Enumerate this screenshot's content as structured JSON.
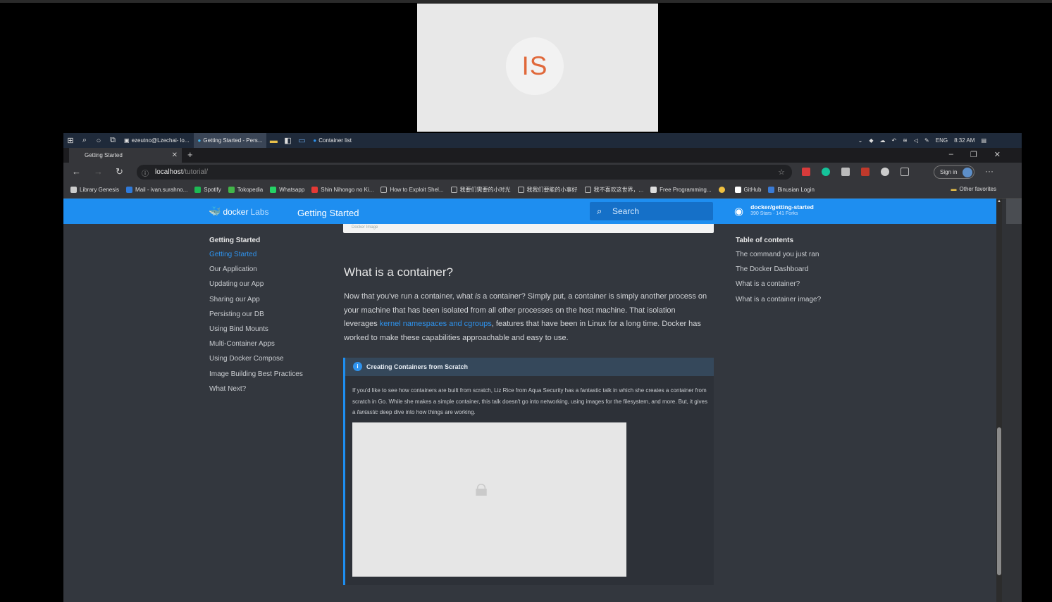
{
  "meeting": {
    "avatar_initials": "IS"
  },
  "taskbar": {
    "apps": [
      {
        "label": "ezeutno@Lzechai- lo..."
      },
      {
        "label": "Getting Started - Pers..."
      },
      {
        "label": "Container list"
      }
    ],
    "lang": "ENG",
    "time": "8:32 AM"
  },
  "browser": {
    "tab_title": "Getting Started",
    "url_host": "localhost",
    "url_path": "/tutorial/",
    "sign_in": "Sign in",
    "bookmarks": [
      {
        "label": "Library Genesis",
        "color": "#cccccc"
      },
      {
        "label": "Mail - ivan.surahno...",
        "color": "#2f7ad9"
      },
      {
        "label": "Spotify",
        "color": "#1db954"
      },
      {
        "label": "Tokopedia",
        "color": "#42b549"
      },
      {
        "label": "Whatsapp",
        "color": "#25d366"
      },
      {
        "label": "Shin Nihongo no Ki...",
        "color": "#e53935"
      },
      {
        "label": "How to Exploit Shel...",
        "color": "#bbbbbb"
      },
      {
        "label": "我要们需要的小时光",
        "color": "#bbbbbb"
      },
      {
        "label": "我我们要能的小事好",
        "color": "#bbbbbb"
      },
      {
        "label": "我不喜欢这世界，...",
        "color": "#bbbbbb"
      },
      {
        "label": "Free Programming...",
        "color": "#dddddd"
      },
      {
        "label": "",
        "color": "#f0c040"
      },
      {
        "label": "GitHub",
        "color": "#ffffff"
      },
      {
        "label": "Binusian Login",
        "color": "#3a7bd5"
      }
    ],
    "other_favorites": "Other favorites"
  },
  "page": {
    "logo_docker": "docker",
    "logo_labs": "Labs",
    "header_title": "Getting Started",
    "search_placeholder": "Search",
    "repo_name": "docker/getting-started",
    "repo_stats": "390 Stars · 141 Forks",
    "image_badge": "Docker Image",
    "nav_section": "Getting Started",
    "nav_items": [
      "Getting Started",
      "Our Application",
      "Updating our App",
      "Sharing our App",
      "Persisting our DB",
      "Using Bind Mounts",
      "Multi-Container Apps",
      "Using Docker Compose",
      "Image Building Best Practices",
      "What Next?"
    ],
    "toc_title": "Table of contents",
    "toc_items": [
      "The command you just ran",
      "The Docker Dashboard",
      "What is a container?",
      "What is a container image?"
    ],
    "heading": "What is a container?",
    "para_1": "Now that you've run a container, what ",
    "para_em": "is",
    "para_2": " a container? Simply put, a container is simply another process on your machine that has been isolated from all other processes on the host machine. That isolation leverages ",
    "para_link": "kernel namespaces and cgroups",
    "para_3": ", features that have been in Linux for a long time. Docker has worked to make these capabilities approachable and easy to use.",
    "note_title": "Creating Containers from Scratch",
    "note_1": "If you'd like to see how containers are built from scratch, Liz Rice from Aqua Security has a fantastic talk in which she creates a container from scratch in Go. While she makes a simple container, this talk doesn't go into networking, using images for the filesystem, and more. But, it gives a ",
    "note_em": "fantastic",
    "note_2": " deep dive into how things are working."
  }
}
